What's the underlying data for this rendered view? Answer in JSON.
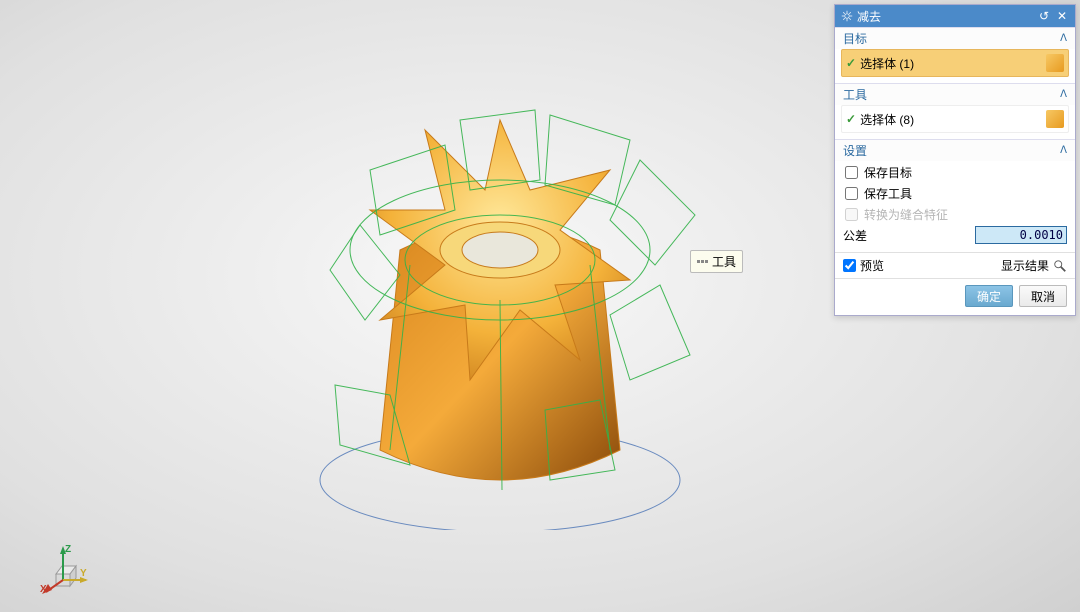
{
  "panel": {
    "title": "减去",
    "sections": {
      "target": {
        "label": "目标",
        "row": "选择体 (1)"
      },
      "tool": {
        "label": "工具",
        "row": "选择体 (8)"
      },
      "settings": {
        "label": "设置",
        "keep_target": "保存目标",
        "keep_tool": "保存工具",
        "convert": "转换为缝合特征",
        "tolerance_label": "公差",
        "tolerance_value": "0.0010"
      }
    },
    "footer": {
      "preview": "预览",
      "show_result": "显示结果"
    },
    "buttons": {
      "ok": "确定",
      "cancel": "取消"
    }
  },
  "tooltip": "工具",
  "axis": {
    "x": "X",
    "y": "Y",
    "z": "Z"
  }
}
